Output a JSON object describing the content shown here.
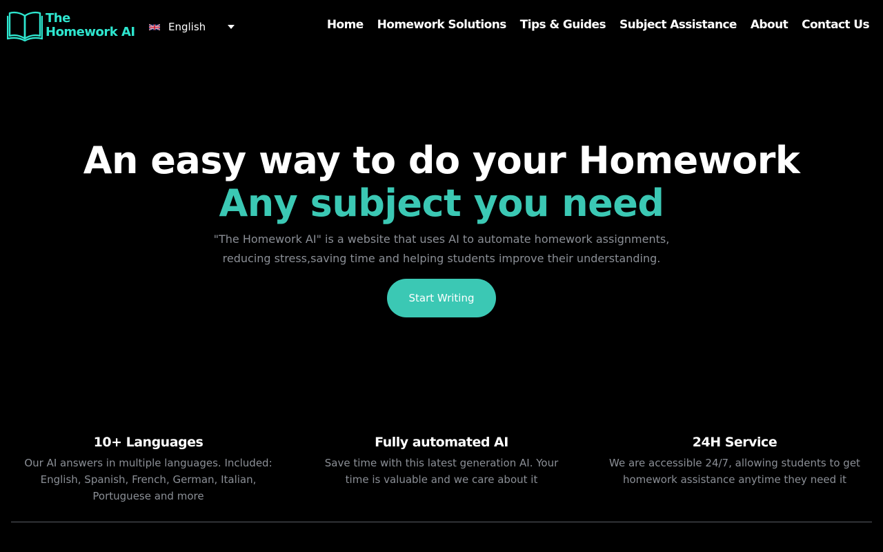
{
  "brand": {
    "line1": "The",
    "line2": "Homework AI",
    "logo_icon": "open-book-icon",
    "color": "#2ee6cf"
  },
  "language": {
    "flag_icon": "uk-flag-icon",
    "selected": "English"
  },
  "nav": {
    "items": [
      {
        "label": "Home"
      },
      {
        "label": "Homework Solutions"
      },
      {
        "label": "Tips & Guides"
      },
      {
        "label": "Subject Assistance"
      },
      {
        "label": "About"
      },
      {
        "label": "Contact Us"
      }
    ]
  },
  "hero": {
    "title": "An easy way to do your Homework",
    "subtitle": "Any subject you need",
    "description": "\"The Homework AI\" is a website that uses AI to automate homework assignments, reducing stress,saving time and helping students improve their understanding.",
    "cta_label": "Start Writing"
  },
  "features": [
    {
      "title": "10+ Languages",
      "text": "Our AI answers in multiple languages. Included: English, Spanish, French, German, Italian, Portuguese and more"
    },
    {
      "title": "Fully automated AI",
      "text": "Save time with this latest generation AI. Your time is valuable and we care about it"
    },
    {
      "title": "24H Service",
      "text": "We are accessible 24/7, allowing students to get homework assistance anytime they need it"
    }
  ],
  "colors": {
    "background": "#000000",
    "accent": "#3bc8b4",
    "muted_text": "#8b8f96"
  }
}
